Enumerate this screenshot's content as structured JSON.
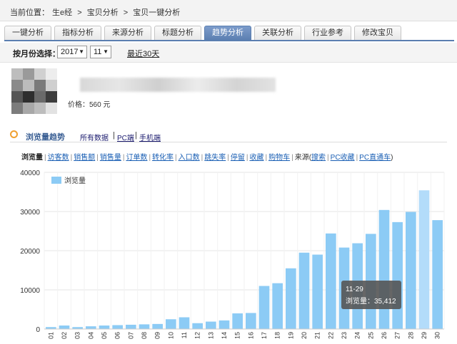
{
  "breadcrumb": {
    "prefix": "当前位置：",
    "items": [
      "生e经",
      ">",
      "宝贝分析",
      ">",
      "宝贝一键分析"
    ]
  },
  "tabs": [
    {
      "label": "一键分析",
      "active": false
    },
    {
      "label": "指标分析",
      "active": false
    },
    {
      "label": "来源分析",
      "active": false
    },
    {
      "label": "标题分析",
      "active": false
    },
    {
      "label": "趋势分析",
      "active": true
    },
    {
      "label": "关联分析",
      "active": false
    },
    {
      "label": "行业参考",
      "active": false
    },
    {
      "label": "修改宝贝",
      "active": false
    }
  ],
  "month_selector": {
    "label": "按月份选择：",
    "year": "2017",
    "month": "11",
    "recent_link": "最近30天"
  },
  "product": {
    "price": "价格：560 元"
  },
  "trend_section": {
    "title": "浏览量趋势",
    "all_data": "所有数据",
    "pc": "PC端",
    "mobile": "手机端"
  },
  "metrics": {
    "current": "浏览量",
    "links": [
      "访客数",
      "销售额",
      "销售量",
      "订单数",
      "转化率",
      "入口数",
      "跳失率",
      "停留",
      "收藏",
      "购物车"
    ],
    "source_label": "来源(",
    "source_links": [
      "搜索",
      "PC收藏",
      "PC直通车"
    ],
    "source_close": ")"
  },
  "tooltip": {
    "date": "11-29",
    "text": "浏览量：35,412"
  },
  "colors": {
    "bar": "#8ccbf5",
    "bar_highlight": "#b3dcfa",
    "tab_active": "#5a7eb0",
    "grid": "#e6e6e6",
    "tooltip_bg": "#555555"
  },
  "chart_data": {
    "type": "bar",
    "legend": "浏览量",
    "legend_position": "top-left",
    "grid": true,
    "ylim": [
      0,
      40000
    ],
    "yticks": [
      "0",
      "10000",
      "20000",
      "30000",
      "40000"
    ],
    "categories": [
      "01",
      "02",
      "03",
      "04",
      "05",
      "06",
      "07",
      "08",
      "09",
      "10",
      "11",
      "12",
      "13",
      "14",
      "15",
      "16",
      "17",
      "18",
      "19",
      "20",
      "21",
      "22",
      "23",
      "24",
      "25",
      "26",
      "27",
      "28",
      "29",
      "30"
    ],
    "series": [
      {
        "name": "浏览量",
        "values": [
          500,
          900,
          500,
          700,
          900,
          1000,
          1100,
          1200,
          1300,
          2500,
          3000,
          1500,
          1900,
          2200,
          4000,
          4100,
          11000,
          11700,
          15500,
          19500,
          19000,
          24400,
          20800,
          21900,
          24300,
          30400,
          27300,
          29900,
          35412,
          27800
        ]
      }
    ],
    "highlight_index": 28
  }
}
